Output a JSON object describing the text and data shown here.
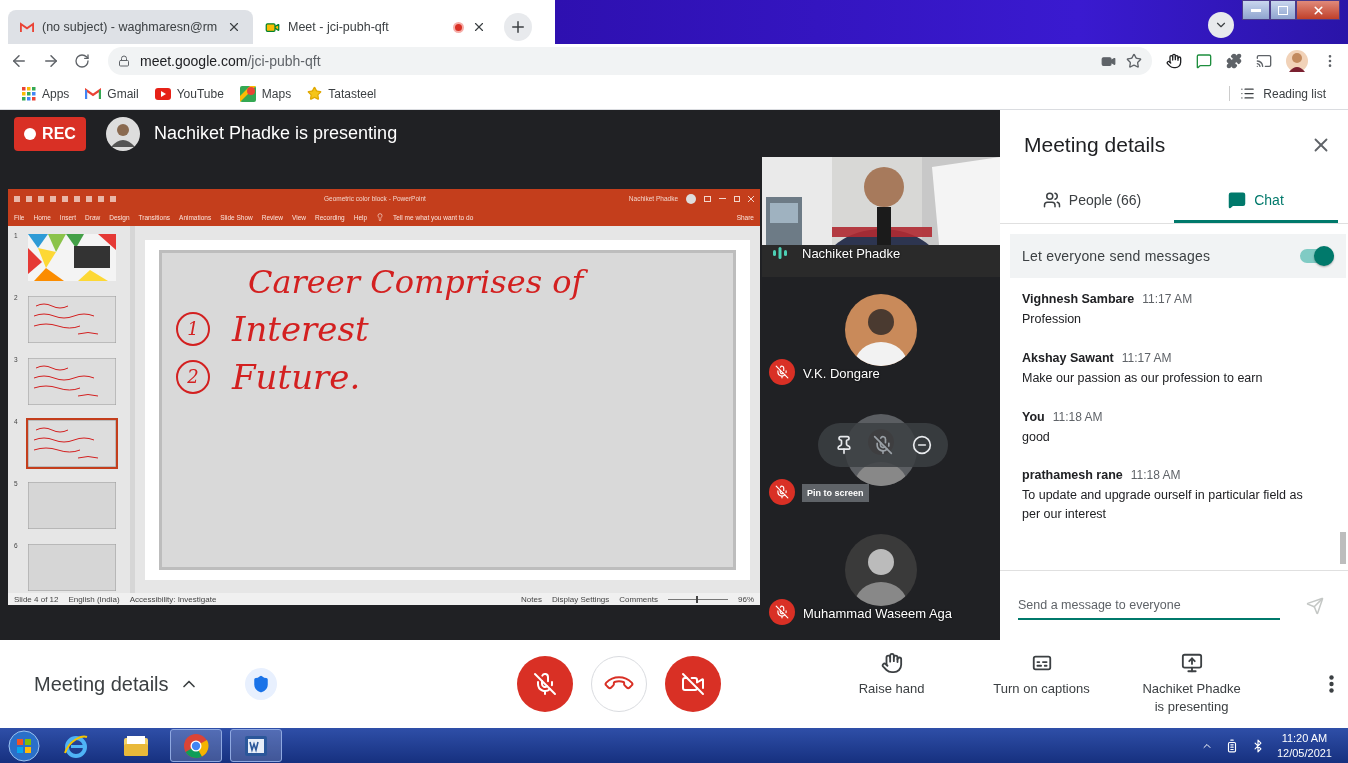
{
  "browser": {
    "tabs": [
      {
        "title": "(no subject) - waghmaresn@rm",
        "selected": false,
        "recording": false
      },
      {
        "title": "Meet - jci-pubh-qft",
        "selected": true,
        "recording": true
      }
    ],
    "url": {
      "host": "meet.google.com",
      "path": "/jci-pubh-qft"
    },
    "bookmarks": [
      {
        "label": "Apps",
        "kind": "apps"
      },
      {
        "label": "Gmail",
        "kind": "gmail"
      },
      {
        "label": "YouTube",
        "kind": "youtube"
      },
      {
        "label": "Maps",
        "kind": "maps"
      },
      {
        "label": "Tatasteel",
        "kind": "star"
      }
    ],
    "reading_list": "Reading list"
  },
  "meet": {
    "recording": {
      "label": "REC"
    },
    "presenter": "Nachiket Phadke is presenting",
    "powerpoint": {
      "title": "Geometric color block - PowerPoint",
      "user": "Nachiket Phadke",
      "menu": [
        "File",
        "Home",
        "Insert",
        "Draw",
        "Design",
        "Transitions",
        "Animations",
        "Slide Show",
        "Review",
        "View",
        "Recording",
        "Help"
      ],
      "tell_me": "Tell me what you want to do",
      "share": "Share",
      "thumbnails": [
        {
          "number": "1",
          "kind": "title",
          "selected": false
        },
        {
          "number": "2",
          "kind": "notes",
          "selected": false
        },
        {
          "number": "3",
          "kind": "notes",
          "selected": false
        },
        {
          "number": "4",
          "kind": "notes",
          "selected": true
        },
        {
          "number": "5",
          "kind": "blank",
          "selected": false
        },
        {
          "number": "6",
          "kind": "blank",
          "selected": false
        }
      ],
      "slide": {
        "heading": "Career Comprises of",
        "points": [
          {
            "number": "1",
            "text": "Interest"
          },
          {
            "number": "2",
            "text": "Future."
          }
        ]
      },
      "status": {
        "slide": "Slide 4 of 12",
        "language": "English (India)",
        "accessibility": "Accessibility: Investigate",
        "notes": "Notes",
        "display": "Display Settings",
        "comments": "Comments",
        "zoom_slider": {
          "level": 0.47
        },
        "zoom": "96%"
      }
    },
    "participants": [
      {
        "kind": "video",
        "name": "Nachiket Phadke",
        "speaking": true,
        "muted": false
      },
      {
        "kind": "avatar",
        "name": "V.K. Dongare",
        "muted": true
      },
      {
        "kind": "avatar",
        "muted": true,
        "hover": true,
        "tooltip": "Pin to screen"
      },
      {
        "kind": "avatar",
        "name": "Muhammad Waseem Aga",
        "muted": true
      }
    ],
    "details": {
      "title": "Meeting details",
      "tabs": [
        {
          "label": "People (66)",
          "kind": "people",
          "selected": false
        },
        {
          "label": "Chat",
          "kind": "chat",
          "selected": true
        }
      ],
      "setting": {
        "label": "Let everyone send messages",
        "on": true
      },
      "messages": [
        {
          "sender": "Vighnesh Sambare",
          "time": "11:17 AM",
          "text": "Profession"
        },
        {
          "sender": "Akshay Sawant",
          "time": "11:17 AM",
          "text": "Make our passion as our profession to earn"
        },
        {
          "sender": "You",
          "time": "11:18 AM",
          "text": "good"
        },
        {
          "sender": "prathamesh rane",
          "time": "11:18 AM",
          "text": "To update and upgrade ourself in particular field as per our interest"
        }
      ],
      "input": {
        "placeholder": "Send a message to everyone"
      }
    },
    "bar": {
      "details": "Meeting details",
      "controls": [
        {
          "kind": "mic",
          "on": false
        },
        {
          "kind": "hangup"
        },
        {
          "kind": "camera",
          "on": false
        }
      ],
      "actions": [
        {
          "kind": "hand",
          "label": "Raise hand"
        },
        {
          "kind": "captions",
          "label": "Turn on captions"
        },
        {
          "kind": "present",
          "label": "Nachiket Phadke is presenting"
        }
      ]
    }
  },
  "taskbar": {
    "apps": [
      {
        "kind": "ie",
        "open": false
      },
      {
        "kind": "explorer",
        "open": false
      },
      {
        "kind": "chrome",
        "open": true
      },
      {
        "kind": "word",
        "open": true
      }
    ],
    "time": "11:20 AM",
    "date": "12/05/2021"
  }
}
